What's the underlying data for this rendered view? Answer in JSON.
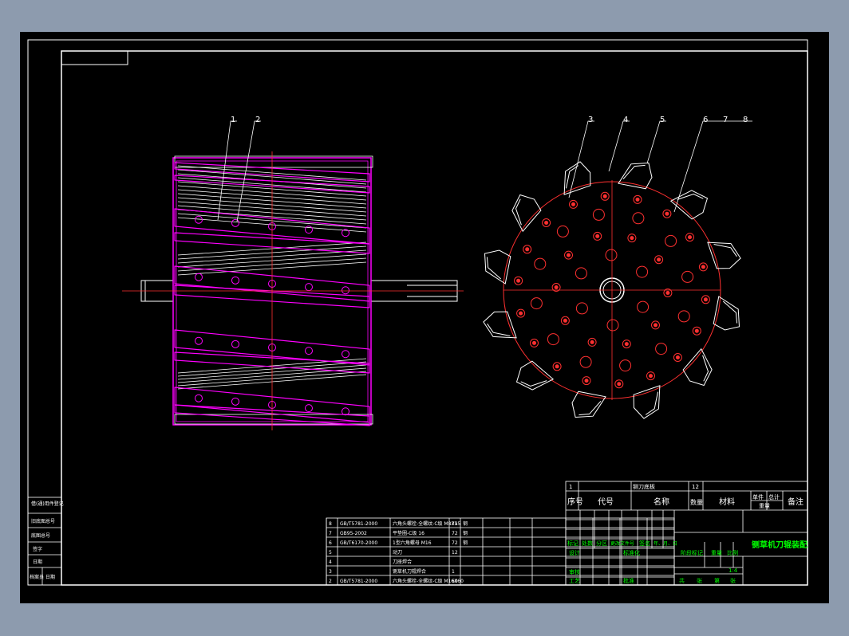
{
  "part_numbers": [
    "1",
    "2",
    "3",
    "4",
    "5",
    "6",
    "7",
    "8"
  ],
  "title_block": {
    "title": "铡草机刀辊装配",
    "row_item1": "1",
    "row_item1_name": "铡刀底板",
    "row_item1_qty": "12",
    "headers": {
      "no": "序号",
      "code": "代号",
      "name": "名称",
      "qty": "数量",
      "material": "材料",
      "single": "单件",
      "total": "总计",
      "weight": "重量",
      "remark": "备注"
    },
    "rev_labels": [
      "标记",
      "处数",
      "分区",
      "更改文件号",
      "签名",
      "年、月、日"
    ],
    "role_labels": {
      "design": "设计",
      "standard": "标准化",
      "check": "审核",
      "process": "工艺",
      "approve": "批准"
    },
    "stage_labels": {
      "stage": "阶段标记",
      "weight": "重量",
      "scale": "比例"
    },
    "scale": "1:4",
    "sheet_labels": [
      "共",
      "张",
      "第",
      "张"
    ]
  },
  "bom_rows": [
    {
      "no": "8",
      "code": "GB/T5781-2000",
      "name": "六角头螺栓-全螺纹-C级 M8X55",
      "qty": "72",
      "mat": "钢"
    },
    {
      "no": "7",
      "code": "GB95-2002",
      "name": "平垫圈-C级 16",
      "qty": "72",
      "mat": "钢"
    },
    {
      "no": "6",
      "code": "GB/T6170-2000",
      "name": "1型六角螺母 M16",
      "qty": "72",
      "mat": "钢"
    },
    {
      "no": "5",
      "code": "",
      "name": "动刀",
      "qty": "12",
      "mat": ""
    },
    {
      "no": "4",
      "code": "",
      "name": "刀座焊合",
      "qty": "",
      "mat": ""
    },
    {
      "no": "3",
      "code": "",
      "name": "铡草机刀辊焊合",
      "qty": "1",
      "mat": ""
    },
    {
      "no": "2",
      "code": "GB/T5781-2000",
      "name": "六角头螺栓-全螺纹-C级 M16X60",
      "qty": "60",
      "mat": ""
    }
  ],
  "side_labels": [
    "借(通)用件登记",
    "旧底图总号",
    "底图总号",
    "签字",
    "日期",
    "档案员",
    "日期"
  ],
  "colors": {
    "sheet": "#000000",
    "frame": "#ffffff",
    "shaft": "#ff00ff",
    "hole": "#ff2020",
    "label": "#00ff00"
  }
}
